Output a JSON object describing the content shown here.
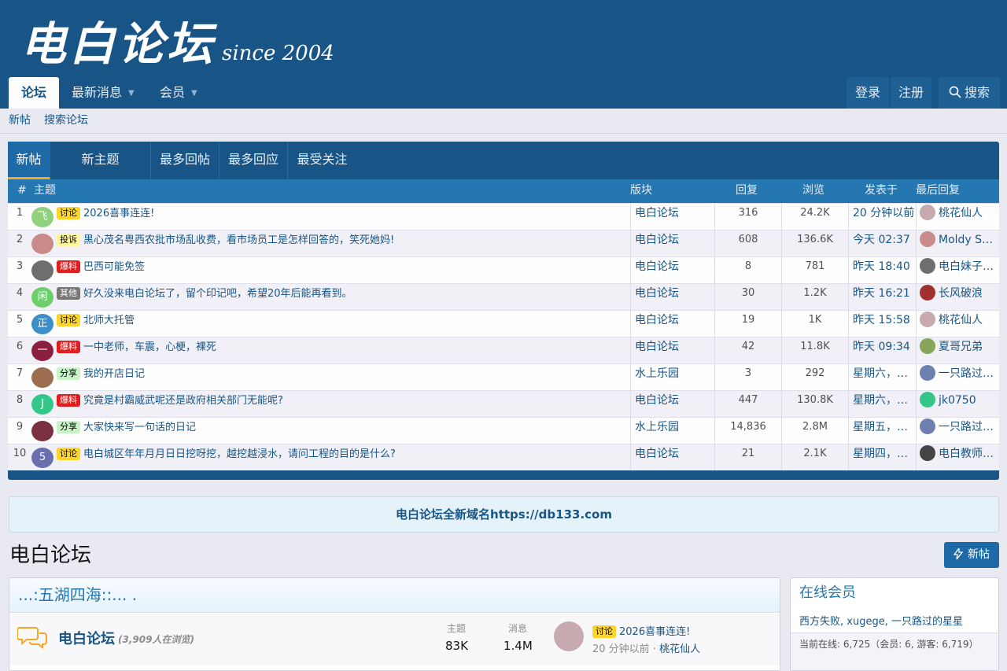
{
  "header": {
    "brand": "电白论坛",
    "since": "since 2004",
    "nav": [
      {
        "label": "论坛",
        "active": true
      },
      {
        "label": "最新消息",
        "dropdown": true
      },
      {
        "label": "会员",
        "dropdown": true
      }
    ],
    "login": "登录",
    "register": "注册",
    "search": "搜索"
  },
  "subnav": {
    "items": [
      "新帖",
      "搜索论坛"
    ]
  },
  "new_posts": {
    "tabs": [
      "新帖",
      "新主题",
      "最多回帖",
      "最多回应",
      "最受关注"
    ],
    "columns": {
      "num": "#",
      "title": "主题",
      "forum": "版块",
      "replies": "回复",
      "views": "浏览",
      "posted": "发表于",
      "last": "最后回复"
    },
    "rows": [
      {
        "num": "1",
        "avatar": "飞",
        "avatar_color": "#8fd17c",
        "badge": "讨论",
        "badge_type": "discuss",
        "title": "2026喜事连连!",
        "forum": "电白论坛",
        "replies": "316",
        "views": "24.2K",
        "posted": "20 分钟以前",
        "last_user": "桃花仙人",
        "last_av": "#c7aab0"
      },
      {
        "num": "2",
        "avatar": "",
        "avatar_color": "#c98a8a",
        "badge": "投诉",
        "badge_type": "complaint",
        "title": "黑心茂名粤西农批市场乱收费，看市场员工是怎样回答的，笑死她妈!",
        "forum": "电白论坛",
        "replies": "608",
        "views": "136.6K",
        "posted": "今天 02:37",
        "last_user": "Moldy So…",
        "last_av": "#c98a8a"
      },
      {
        "num": "3",
        "avatar": "",
        "avatar_color": "#6e6e6e",
        "badge": "爆料",
        "badge_type": "news",
        "title": "巴西可能免签",
        "forum": "电白论坛",
        "replies": "8",
        "views": "781",
        "posted": "昨天 18:40",
        "last_user": "电白妹子…",
        "last_av": "#6e6e6e"
      },
      {
        "num": "4",
        "avatar": "闲",
        "avatar_color": "#6ccf6c",
        "badge": "其他",
        "badge_type": "other",
        "title": "好久没来电白论坛了，留个印记吧，希望20年后能再看到。",
        "forum": "电白论坛",
        "replies": "30",
        "views": "1.2K",
        "posted": "昨天 16:21",
        "last_user": "长风破浪",
        "last_av": "#a0312f"
      },
      {
        "num": "5",
        "avatar": "正",
        "avatar_color": "#3d8fc7",
        "badge": "讨论",
        "badge_type": "discuss",
        "title": "北师大托管",
        "forum": "电白论坛",
        "replies": "19",
        "views": "1K",
        "posted": "昨天 15:58",
        "last_user": "桃花仙人",
        "last_av": "#c7aab0"
      },
      {
        "num": "6",
        "avatar": "一",
        "avatar_color": "#8a1f3f",
        "badge": "爆料",
        "badge_type": "news",
        "title": "一中老师，车震，心梗，裸死",
        "forum": "电白论坛",
        "replies": "42",
        "views": "11.8K",
        "posted": "昨天 09:34",
        "last_user": "夏哥兄弟",
        "last_av": "#86a65a"
      },
      {
        "num": "7",
        "avatar": "",
        "avatar_color": "#9a6e4f",
        "badge": "分享",
        "badge_type": "share",
        "title": "我的开店日记",
        "forum": "水上乐园",
        "replies": "3",
        "views": "292",
        "posted": "星期六，…",
        "last_user": "一只路过…",
        "last_av": "#6f7fb0"
      },
      {
        "num": "8",
        "avatar": "J",
        "avatar_color": "#35c78a",
        "badge": "爆料",
        "badge_type": "news",
        "title": "究竟是村霸威武呢还是政府相关部门无能呢?",
        "forum": "电白论坛",
        "replies": "447",
        "views": "130.8K",
        "posted": "星期六，…",
        "last_user": "jk0750",
        "last_av": "#35c78a"
      },
      {
        "num": "9",
        "avatar": "",
        "avatar_color": "#7a3040",
        "badge": "分享",
        "badge_type": "share",
        "title": "大家快来写一句话的日记",
        "forum": "水上乐园",
        "replies": "14,836",
        "views": "2.8M",
        "posted": "星期五，…",
        "last_user": "一只路过…",
        "last_av": "#6f7fb0"
      },
      {
        "num": "10",
        "avatar": "5",
        "avatar_color": "#6b6fb0",
        "badge": "讨论",
        "badge_type": "discuss",
        "title": "电白城区年年月月日日挖呀挖，越挖越浸水，请问工程的目的是什么?",
        "forum": "电白论坛",
        "replies": "21",
        "views": "2.1K",
        "posted": "星期四，…",
        "last_user": "电白教师…",
        "last_av": "#444"
      }
    ]
  },
  "notice": "电白论坛全新域名https://db133.com",
  "page_title": "电白论坛",
  "new_thread_btn": "新帖",
  "category": {
    "title": "...:五湖四海::... .",
    "forum": {
      "name": "电白论坛",
      "viewing": "(3,909人在浏览)",
      "threads_label": "主题",
      "threads": "83K",
      "messages_label": "消息",
      "messages": "1.4M",
      "latest_badge": "讨论",
      "latest_title": "2026喜事连连!",
      "latest_time": "20 分钟以前",
      "latest_sep": "·",
      "latest_user": "桃花仙人"
    }
  },
  "online": {
    "title": "在线会员",
    "members": "西方失败, xugege, 一只路过的星星",
    "stats": "当前在线:  6,725（会员:  6, 游客:  6,719）"
  },
  "colors": {
    "header": "#185586",
    "link": "#185586",
    "accent": "#f6a623"
  }
}
